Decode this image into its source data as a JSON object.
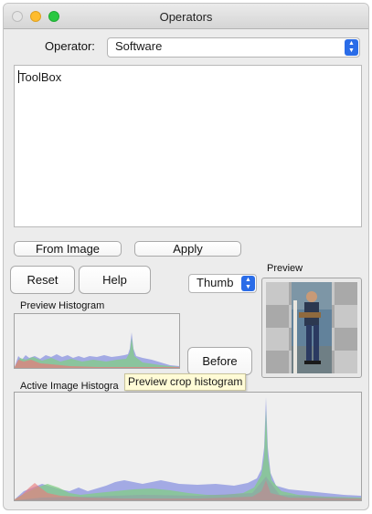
{
  "window": {
    "title": "Operators"
  },
  "operator": {
    "label": "Operator:",
    "selected": "Software"
  },
  "editor": {
    "text": "ToolBox"
  },
  "buttons": {
    "from_image": "From Image",
    "apply": "Apply",
    "reset": "Reset",
    "help": "Help",
    "before": "Before"
  },
  "thumb_select": {
    "selected": "Thumb"
  },
  "labels": {
    "preview": "Preview",
    "preview_histogram": "Preview Histogram",
    "active_image_histogram": "Active Image Histogra"
  },
  "tooltip": {
    "text": "Preview crop histogram"
  },
  "colors": {
    "accent": "#2a6ce8",
    "hist_red": "#e86a6a",
    "hist_green": "#6ec86e",
    "hist_blue": "#7f86e6",
    "hist_gray": "#8d9aa8"
  },
  "icons": {
    "select_chevron": "chevron-updown-icon"
  }
}
